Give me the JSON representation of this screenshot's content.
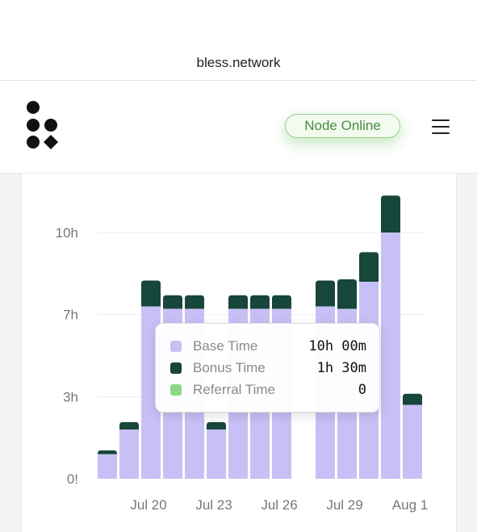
{
  "browser": {
    "url": "bless.network"
  },
  "header": {
    "node_status": "Node Online",
    "menu_icon": "hamburger-menu-icon",
    "logo_icon": "bless-logo-icon"
  },
  "colors": {
    "base": "#c7c0f6",
    "bonus": "#17463a",
    "referral": "#8fd585",
    "status_green": "#4a8b3d"
  },
  "chart_data": {
    "type": "bar",
    "stacked": true,
    "ylim": [
      0,
      11.5
    ],
    "y_ticks": [
      {
        "label": "0!",
        "value": 0
      },
      {
        "label": "3h",
        "value": 3.333
      },
      {
        "label": "7h",
        "value": 6.667
      },
      {
        "label": "10h",
        "value": 10
      }
    ],
    "x_ticks": [
      "Jul 20",
      "Jul 23",
      "Jul 26",
      "Jul 29",
      "Aug 1"
    ],
    "x_tick_positions": [
      2,
      5,
      8,
      11,
      14
    ],
    "grid": true,
    "series": [
      {
        "name": "Base Time",
        "color": "#c7c0f6",
        "values": [
          1.0,
          2.0,
          7.0,
          6.9,
          6.9,
          2.0,
          6.9,
          6.9,
          6.9,
          null,
          7.0,
          6.9,
          8.0,
          10.0,
          3.0
        ]
      },
      {
        "name": "Bonus Time",
        "color": "#17463a",
        "values": [
          0.15,
          0.3,
          1.05,
          0.55,
          0.55,
          0.3,
          0.55,
          0.55,
          0.55,
          null,
          1.05,
          1.2,
          1.2,
          1.5,
          0.45
        ]
      },
      {
        "name": "Referral Time",
        "color": "#8fd585",
        "values": [
          0,
          0,
          0,
          0,
          0,
          0,
          0,
          0,
          0,
          null,
          0,
          0,
          0,
          0,
          0
        ]
      }
    ],
    "tooltip": {
      "rows": [
        {
          "label": "Base Time",
          "value": "10h 00m",
          "color": "#c7c0f6"
        },
        {
          "label": "Bonus Time",
          "value": "1h 30m",
          "color": "#17463a"
        },
        {
          "label": "Referral Time",
          "value": "0",
          "color": "#8fd585"
        }
      ]
    }
  }
}
